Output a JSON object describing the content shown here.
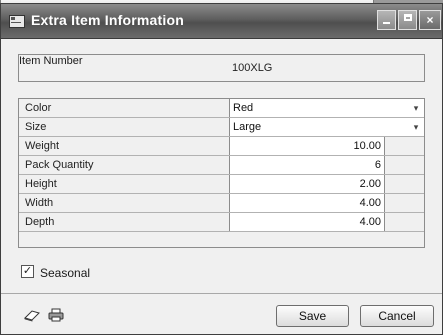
{
  "window": {
    "title": "Extra Item Information",
    "buttons": {
      "minimize": "_",
      "maximize": "□",
      "close": "×"
    }
  },
  "item_number": {
    "label": "Item Number",
    "value": "100XLG"
  },
  "fields": {
    "color": {
      "label": "Color",
      "value": "Red"
    },
    "size": {
      "label": "Size",
      "value": "Large"
    },
    "weight": {
      "label": "Weight",
      "value": "10.00"
    },
    "pack_quantity": {
      "label": "Pack Quantity",
      "value": "6"
    },
    "height": {
      "label": "Height",
      "value": "2.00"
    },
    "width": {
      "label": "Width",
      "value": "4.00"
    },
    "depth": {
      "label": "Depth",
      "value": "4.00"
    }
  },
  "seasonal": {
    "label": "Seasonal",
    "checked": true,
    "mark": "✓"
  },
  "footer": {
    "icons": [
      "eraser-icon",
      "printer-icon"
    ],
    "save_label": "Save",
    "cancel_label": "Cancel"
  },
  "select_arrow": "▾"
}
